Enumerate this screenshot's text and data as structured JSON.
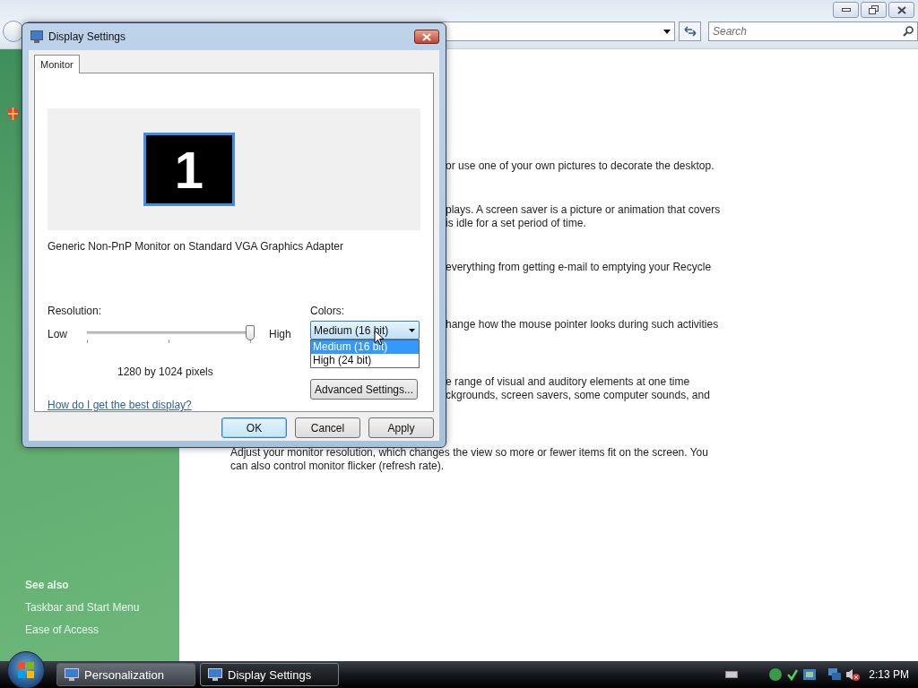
{
  "explorer": {
    "search": {
      "placeholder": "Search"
    }
  },
  "sidebar": {
    "heading": "See also",
    "links": [
      "Taskbar and Start Menu",
      "Ease of Access"
    ]
  },
  "content": {
    "paragraphs": [
      {
        "kind": "covered",
        "lines": [
          "or use one of your own pictures to decorate the desktop."
        ]
      },
      {
        "kind": "covered",
        "lines": [
          "plays. A screen saver is a picture or animation that covers",
          "is idle for a set period of time."
        ]
      },
      {
        "kind": "covered",
        "lines": [
          "everything from getting e-mail to emptying your Recycle"
        ]
      },
      {
        "kind": "covered",
        "lines": [
          "hange how the mouse pointer looks during such activities"
        ]
      },
      {
        "kind": "covered",
        "lines": [
          "e range of visual and auditory elements at one time",
          "ckgrounds, screen savers, some computer sounds, and"
        ]
      },
      {
        "kind": "full",
        "lines": [
          "Adjust your monitor resolution, which changes the view so more or fewer items fit on the screen. You",
          "can also control monitor flicker (refresh rate)."
        ]
      }
    ]
  },
  "dialog": {
    "title": "Display Settings",
    "tabs": [
      {
        "label": "Monitor",
        "selected": true
      }
    ],
    "display_number": "1",
    "adapter": "Generic Non-PnP Monitor on Standard VGA Graphics Adapter",
    "resolution": {
      "label": "Resolution:",
      "low": "Low",
      "high": "High",
      "level": 1,
      "reading": "1280 by 1024 pixels"
    },
    "colors": {
      "label": "Colors:",
      "value": "Medium (16 bit)",
      "expanded": true,
      "options": [
        {
          "label": "Medium (16 bit)",
          "selected": true
        },
        {
          "label": "High (24 bit)",
          "selected": false
        }
      ]
    },
    "help_link": "How do I get the best display?",
    "advanced_button": "Advanced Settings...",
    "buttons": [
      {
        "label": "OK",
        "default": true
      },
      {
        "label": "Cancel",
        "default": false
      },
      {
        "label": "Apply",
        "default": false
      }
    ]
  },
  "taskbar": {
    "items": [
      {
        "label": "Personalization",
        "selected": false
      },
      {
        "label": "Display Settings",
        "selected": true
      }
    ],
    "clock": "2:13 PM"
  }
}
